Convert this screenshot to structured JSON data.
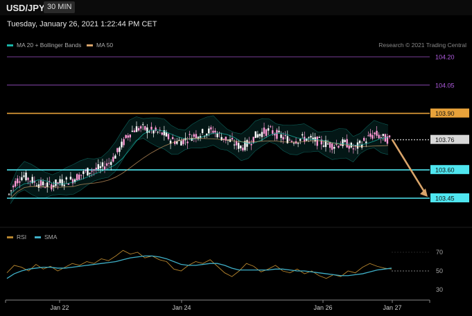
{
  "header": {
    "symbol": "USD/JPY",
    "timeframe": "30 MIN",
    "datetime": "Tuesday, January 26, 2021 1:22:44 PM CET",
    "credit": "Research © 2021 Trading Central"
  },
  "legend": {
    "bollinger": "MA 20 + Bollinger Bands",
    "ma50": "MA 50",
    "rsi": "RSI",
    "sma": "SMA"
  },
  "colors": {
    "bollinger": "#19b5a8",
    "ma50": "#d9a46a",
    "support": "#4fe6f0",
    "resistance": "#e8a23a",
    "target": "#b05ce0",
    "arrow": "#d9a46a",
    "candle_up": "#ffffff",
    "candle_down": "#ff9ad6",
    "rsi": "#b8862e",
    "sma": "#3fb0c8"
  },
  "chart_data": [
    {
      "type": "candlestick",
      "ylim": [
        103.27,
        104.3
      ],
      "levels": [
        {
          "value": 104.2,
          "label": "104.20",
          "kind": "target"
        },
        {
          "value": 104.05,
          "label": "104.05",
          "kind": "target"
        },
        {
          "value": 103.9,
          "label": "103.90",
          "kind": "resistance"
        },
        {
          "value": 103.76,
          "label": "103.76",
          "kind": "last"
        },
        {
          "value": 103.6,
          "label": "103.60",
          "kind": "support"
        },
        {
          "value": 103.45,
          "label": "103.45",
          "kind": "support"
        }
      ],
      "x": [
        "Jan 22",
        "Jan 24",
        "Jan 26",
        "Jan 27"
      ],
      "close_path": [
        103.47,
        103.54,
        103.57,
        103.55,
        103.53,
        103.52,
        103.52,
        103.53,
        103.54,
        103.55,
        103.57,
        103.59,
        103.6,
        103.61,
        103.63,
        103.67,
        103.73,
        103.79,
        103.82,
        103.82,
        103.81,
        103.8,
        103.79,
        103.76,
        103.75,
        103.76,
        103.78,
        103.79,
        103.8,
        103.81,
        103.78,
        103.76,
        103.74,
        103.72,
        103.74,
        103.78,
        103.8,
        103.81,
        103.79,
        103.77,
        103.76,
        103.76,
        103.77,
        103.76,
        103.75,
        103.74,
        103.73,
        103.74,
        103.74,
        103.71,
        103.74,
        103.77,
        103.79,
        103.77,
        103.76
      ],
      "projection": {
        "from": 103.76,
        "to": 103.45
      }
    },
    {
      "type": "line",
      "name": "RSI",
      "ylim": [
        25,
        75
      ],
      "yticks": [
        70,
        50,
        30
      ],
      "series": [
        {
          "name": "RSI",
          "values": [
            48,
            56,
            54,
            50,
            57,
            52,
            55,
            50,
            54,
            58,
            56,
            60,
            58,
            63,
            61,
            66,
            72,
            68,
            70,
            64,
            66,
            62,
            60,
            52,
            50,
            56,
            60,
            58,
            62,
            55,
            48,
            44,
            50,
            58,
            55,
            49,
            52,
            56,
            50,
            48,
            52,
            47,
            50,
            45,
            42,
            46,
            44,
            50,
            48,
            54,
            58,
            55,
            53,
            52
          ]
        },
        {
          "name": "SMA",
          "values": [
            42,
            47,
            50,
            52,
            53,
            54,
            54,
            53,
            53,
            54,
            55,
            56,
            57,
            58,
            59,
            60,
            62,
            64,
            65,
            66,
            66,
            65,
            63,
            60,
            57,
            56,
            56,
            57,
            58,
            58,
            56,
            53,
            51,
            51,
            51,
            51,
            51,
            52,
            52,
            51,
            50,
            50,
            49,
            48,
            47,
            46,
            45,
            45,
            46,
            47,
            49,
            51,
            52,
            53
          ]
        }
      ]
    }
  ]
}
